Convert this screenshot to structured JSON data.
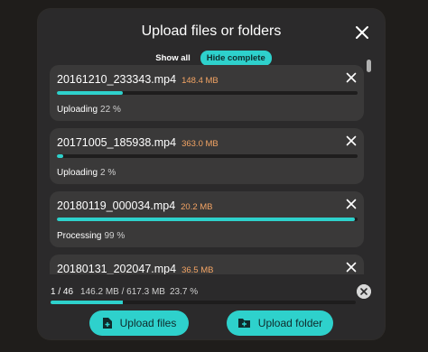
{
  "dialog": {
    "title": "Upload files or folders",
    "filters": {
      "show_all": "Show all",
      "hide_complete": "Hide complete"
    }
  },
  "uploads": [
    {
      "name": "20161210_233343.mp4",
      "size": "148.4 MB",
      "status": "Uploading",
      "percent_label": "22 %",
      "progress": 0.22
    },
    {
      "name": "20171005_185938.mp4",
      "size": "363.0 MB",
      "status": "Uploading",
      "percent_label": "2 %",
      "progress": 0.02
    },
    {
      "name": "20180119_000034.mp4",
      "size": "20.2 MB",
      "status": "Processing",
      "percent_label": "99 %",
      "progress": 0.99
    },
    {
      "name": "20180131_202047.mp4",
      "size": "36.5 MB",
      "status": "",
      "percent_label": "",
      "progress": 0
    }
  ],
  "summary": {
    "count": "1 / 46",
    "transferred": "146.2 MB / 617.3 MB",
    "percent_label": "23.7 %",
    "progress": 0.237
  },
  "buttons": {
    "upload_files": "Upload files",
    "upload_folder": "Upload folder"
  },
  "colors": {
    "accent": "#2ed1cc",
    "size": "#f3a464",
    "card": "#3a3939",
    "dialog": "#2b2a2b"
  }
}
